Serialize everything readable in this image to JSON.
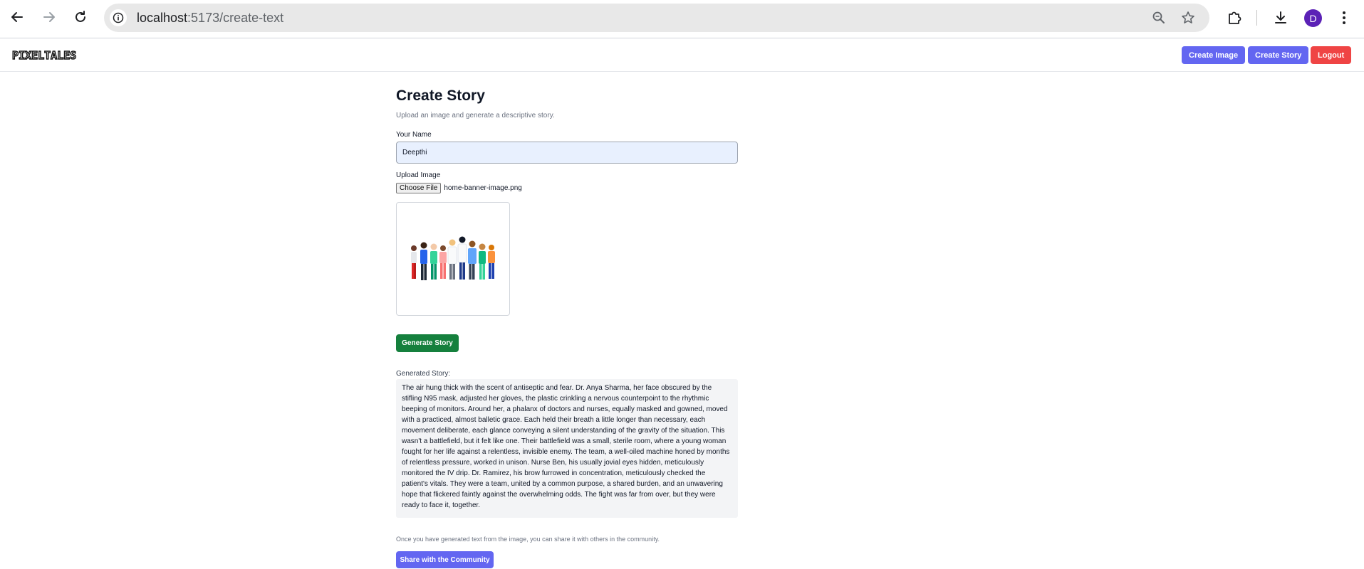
{
  "browser": {
    "url_host": "localhost",
    "url_path": ":5173/create-text",
    "profile_initial": "D"
  },
  "header": {
    "logo_text": "PIXELTALES",
    "create_image_label": "Create Image",
    "create_story_label": "Create Story",
    "logout_label": "Logout"
  },
  "page": {
    "title": "Create Story",
    "subtitle": "Upload an image and generate a descriptive story.",
    "name_label": "Your Name",
    "name_value": "Deepthi",
    "upload_label": "Upload Image",
    "choose_file_label": "Choose File",
    "file_name": "home-banner-image.png",
    "generate_label": "Generate Story",
    "story_label": "Generated Story:",
    "story_text": "The air hung thick with the scent of antiseptic and fear. Dr. Anya Sharma, her face obscured by the stifling N95 mask, adjusted her gloves, the plastic crinkling a nervous counterpoint to the rhythmic beeping of monitors. Around her, a phalanx of doctors and nurses, equally masked and gowned, moved with a practiced, almost balletic grace. Each held their breath a little longer than necessary, each movement deliberate, each glance conveying a silent understanding of the gravity of the situation. This wasn't a battlefield, but it felt like one. Their battlefield was a small, sterile room, where a young woman fought for her life against a relentless, invisible enemy. The team, a well-oiled machine honed by months of relentless pressure, worked in unison. Nurse Ben, his usually jovial eyes hidden, meticulously monitored the IV drip. Dr. Ramirez, his brow furrowed in concentration, meticulously checked the patient's vitals. They were a team, united by a common purpose, a shared burden, and an unwavering hope that flickered faintly against the overwhelming odds. The fight was far from over, but they were ready to face it, together.",
    "share_note": "Once you have generated text from the image, you can share it with others in the community.",
    "share_label": "Share with the Community"
  },
  "colors": {
    "primary": "#6366f1",
    "danger": "#ef4444",
    "success": "#15803d",
    "avatar": "#5b21b6"
  }
}
